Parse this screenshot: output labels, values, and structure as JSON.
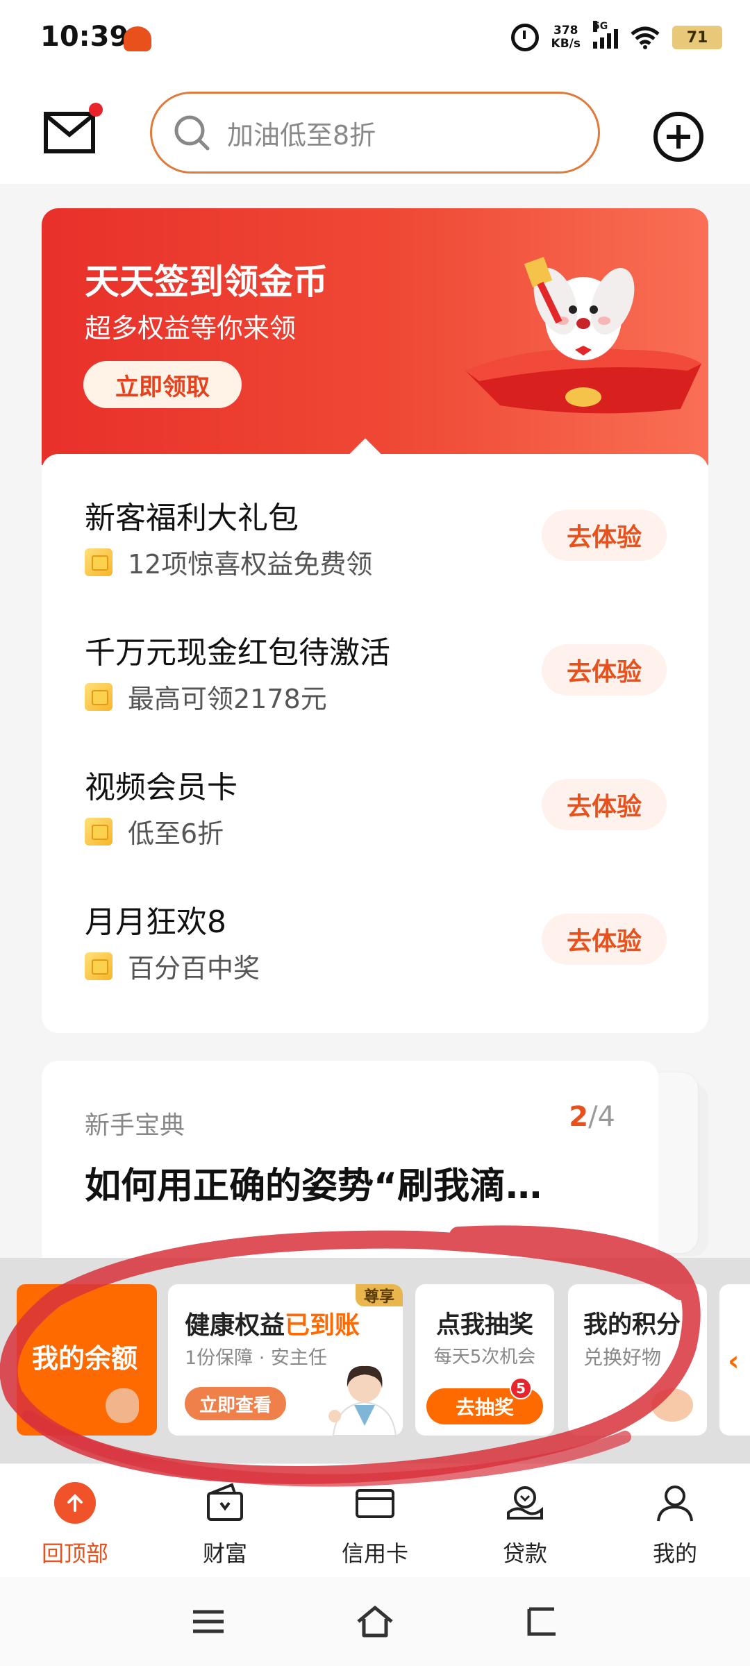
{
  "status_bar": {
    "time": "10:39",
    "net_speed_value": "378",
    "net_speed_unit": "KB/s",
    "network": "5G",
    "battery": "71"
  },
  "header": {
    "search_placeholder": "加油低至8折",
    "mail_icon": "mail-icon",
    "add_icon": "plus-circle-icon"
  },
  "banner": {
    "title": "天天签到领金币",
    "subtitle": "超多权益等你来领",
    "button": "立即领取"
  },
  "tasks": [
    {
      "title": "新客福利大礼包",
      "subtitle": "12项惊喜权益免费领",
      "button": "去体验"
    },
    {
      "title": "千万元现金红包待激活",
      "subtitle": "最高可领2178元",
      "button": "去体验"
    },
    {
      "title": "视频会员卡",
      "subtitle": "低至6折",
      "button": "去体验"
    },
    {
      "title": "月月狂欢8",
      "subtitle": "百分百中奖",
      "button": "去体验"
    }
  ],
  "guide": {
    "label": "新手宝典",
    "page_current": "2",
    "page_total": "/4",
    "title": "如何用正确的姿势“刷我滴…"
  },
  "promo": {
    "balance_label": "我的余额",
    "health": {
      "badge": "尊享",
      "title_prefix": "健康权益",
      "title_highlight": "已到账",
      "subtitle": "1份保障 · 安主任",
      "button": "立即查看"
    },
    "lottery": {
      "title": "点我抽奖",
      "subtitle": "每天5次机会",
      "button": "去抽奖",
      "count": "5"
    },
    "points": {
      "title": "我的积分",
      "subtitle": "兑换好物"
    },
    "more_arrow": "‹"
  },
  "bottom_nav": [
    {
      "label": "回顶部",
      "icon": "arrow-up-icon",
      "active": true
    },
    {
      "label": "财富",
      "icon": "wallet-icon",
      "active": false
    },
    {
      "label": "信用卡",
      "icon": "credit-card-icon",
      "active": false
    },
    {
      "label": "贷款",
      "icon": "loan-icon",
      "active": false
    },
    {
      "label": "我的",
      "icon": "user-icon",
      "active": false
    }
  ],
  "colors": {
    "accent": "#e8501c",
    "banner_start": "#e8302a",
    "banner_end": "#f96f55",
    "promo_orange": "#ff6a00",
    "scribble": "#d8323c"
  }
}
